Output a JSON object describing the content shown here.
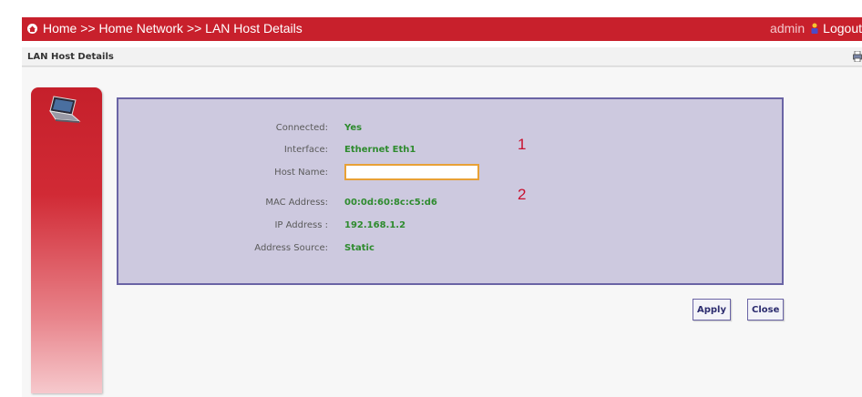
{
  "header": {
    "breadcrumb": "Home >> Home Network >> LAN Host Details",
    "user": "admin",
    "logout_label": "Logout",
    "icons": {
      "home": "home-icon",
      "logout": "logout-icon"
    }
  },
  "subheader": {
    "title": "LAN Host Details",
    "icon": "print-icon"
  },
  "sidebar": {
    "icon": "laptop-icon"
  },
  "details": {
    "connected": {
      "label": "Connected:",
      "value": "Yes"
    },
    "interface": {
      "label": "Interface:",
      "value": "Ethernet Eth1"
    },
    "host_name": {
      "label": "Host Name:",
      "value": "",
      "placeholder": ""
    },
    "mac_address": {
      "label": "MAC Address:",
      "value": "00:0d:60:8c:c5:d6"
    },
    "ip_address": {
      "label": "IP Address :",
      "value": "192.168.1.2"
    },
    "address_source": {
      "label": "Address Source:",
      "value": "Static"
    }
  },
  "annotations": {
    "marker_1": "1",
    "marker_2": "2"
  },
  "actions": {
    "apply_label": "Apply",
    "close_label": "Close"
  },
  "colors": {
    "header_red": "#c8202c",
    "panel_lavender": "#cdc9df",
    "panel_border": "#6a64a5",
    "value_green": "#2e8b2e",
    "marker_red": "#c8102e",
    "input_border": "#e8a136"
  }
}
